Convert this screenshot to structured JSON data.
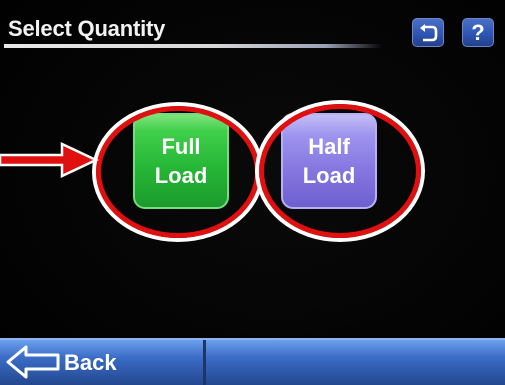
{
  "header": {
    "title": "Select Quantity",
    "help_label": "?"
  },
  "options": {
    "full_load_label": "Full\nLoad",
    "half_load_label": "Half\nLoad"
  },
  "footer": {
    "back_label": "Back"
  },
  "colors": {
    "full_load": "#2fbf3c",
    "half_load": "#8a7ce3",
    "annotation_red": "#e01010",
    "bar_blue": "#3a6bc5"
  },
  "icons": {
    "undo": "undo-icon",
    "back": "back-arrow-icon"
  }
}
